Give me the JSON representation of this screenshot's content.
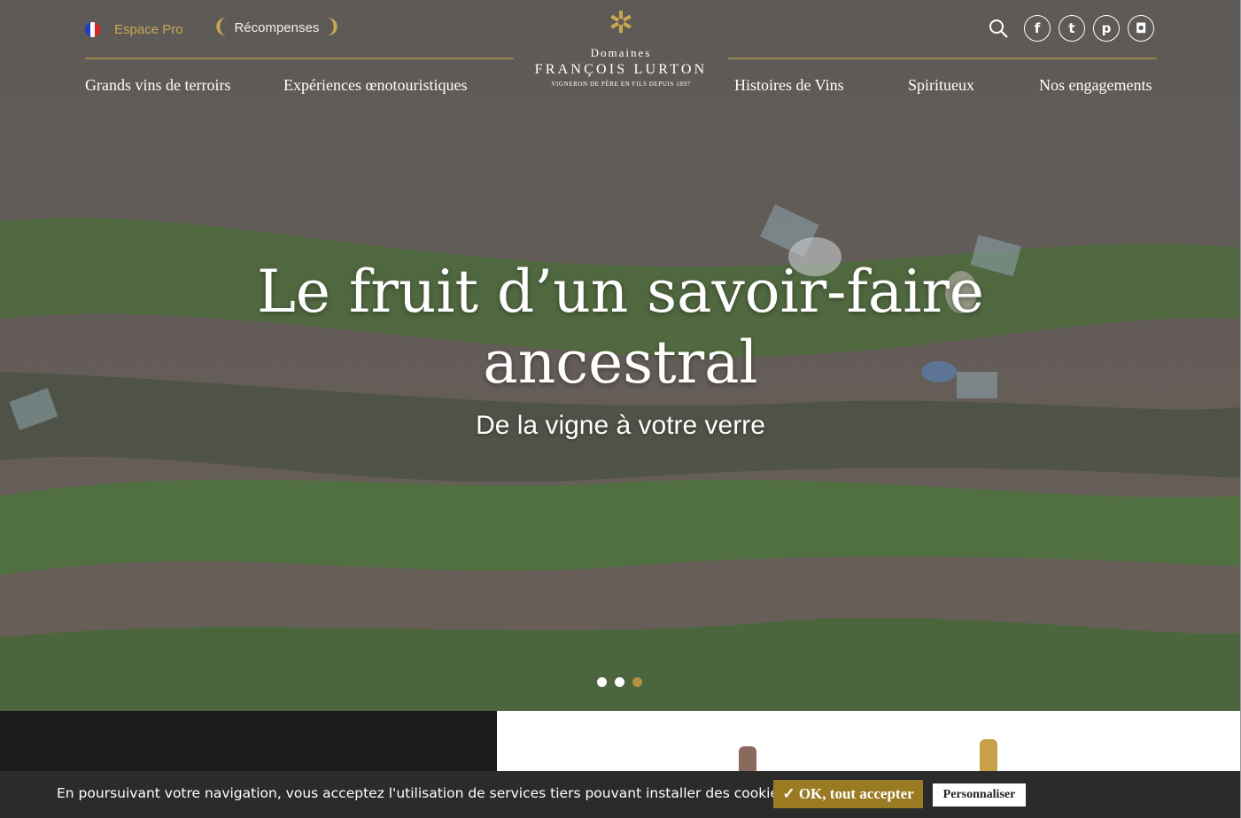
{
  "topbar": {
    "espace_pro": "Espace Pro",
    "recompenses": "Récompenses"
  },
  "logo": {
    "line1": "Domaines",
    "line2": "FRANÇOIS LURTON",
    "line3": "VIGNERON DE PÈRE EN FILS DEPUIS 1897"
  },
  "nav": {
    "items": [
      "Grands vins de terroirs",
      "Expériences œnotouristiques",
      "Histoires de Vins",
      "Spiritueux",
      "Nos engagements"
    ]
  },
  "social": {
    "facebook": "f",
    "twitter": "t",
    "pinterest": "p",
    "instagram": "◘"
  },
  "hero": {
    "headline_line1": "Le fruit d’un savoir-faire",
    "headline_line2": "ancestral",
    "subtitle": "De la vigne à votre verre"
  },
  "carousel": {
    "total": 3,
    "active": 3
  },
  "cookie": {
    "text": "En poursuivant votre navigation, vous acceptez l'utilisation de services tiers pouvant installer des cookies",
    "accept_label": "✓ OK, tout accepter",
    "customize_label": "Personnaliser"
  },
  "colors": {
    "gold": "#c9a94e",
    "accept_button": "#9a7a22"
  }
}
